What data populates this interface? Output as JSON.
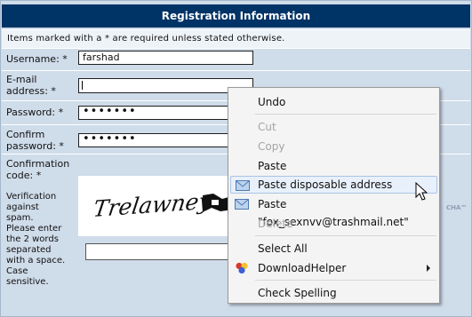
{
  "form": {
    "title": "Registration Information",
    "required_note": "Items marked with a * are required unless stated otherwise.",
    "username_label": "Username: *",
    "username_value": "farshad",
    "email_label_1": "E-mail",
    "email_label_2": "address: *",
    "email_value": "",
    "password_label": "Password: *",
    "password_value": "•••••••",
    "confirm_label_1": "Confirm",
    "confirm_label_2": "password: *",
    "confirm_value": "•••••••",
    "confirmation_label_1": "Confirmation",
    "confirmation_label_2": "code: *",
    "verification_help": [
      "Verification",
      "against",
      "spam.",
      "Please enter",
      "the 2 words",
      "separated",
      "with a space.",
      "Case",
      "sensitive."
    ],
    "captcha_words": "Trelawney",
    "captcha_brand": "CHA™"
  },
  "context_menu": {
    "items": [
      {
        "label": "Undo",
        "disabled": false
      },
      {
        "label": "Cut",
        "disabled": true
      },
      {
        "label": "Copy",
        "disabled": true
      },
      {
        "label": "Paste",
        "disabled": false
      },
      {
        "label": "Paste disposable address",
        "disabled": false,
        "highlighted": true,
        "icon": "envelope-icon"
      },
      {
        "label": "Paste \"fox_sexnvv@trashmail.net\"",
        "disabled": false,
        "icon": "envelope-icon"
      },
      {
        "label": "Delete",
        "disabled": true
      },
      {
        "label": "Select All",
        "disabled": false
      },
      {
        "label": "DownloadHelper",
        "disabled": false,
        "icon": "downloadhelper-icon",
        "submenu": true
      },
      {
        "label": "Check Spelling",
        "disabled": false
      }
    ]
  },
  "colors": {
    "title_bg": "#003366",
    "form_bg": "#cfdcea",
    "menu_bg": "#f4f4f4",
    "highlight_bg": "#e8f0fb"
  }
}
